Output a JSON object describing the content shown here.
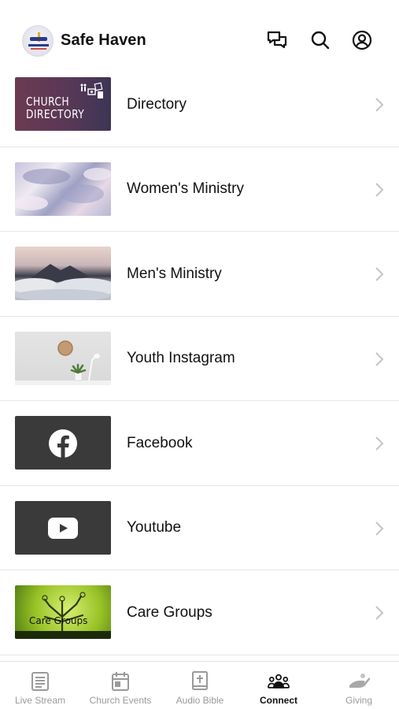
{
  "header": {
    "title": "Safe Haven",
    "icons": [
      "church-logo",
      "messages-icon",
      "search-icon",
      "account-icon"
    ]
  },
  "items": [
    {
      "label": "Directory",
      "thumb": "church-directory-image",
      "thumb_text": [
        "CHURCH",
        "DIRECTORY"
      ]
    },
    {
      "label": "Women's Ministry",
      "thumb": "pastel-clouds-image"
    },
    {
      "label": "Men's Ministry",
      "thumb": "mountain-clouds-image"
    },
    {
      "label": "Youth Instagram",
      "thumb": "clock-plant-desk-image"
    },
    {
      "label": "Facebook",
      "thumb": "facebook-icon"
    },
    {
      "label": "Youtube",
      "thumb": "youtube-icon"
    },
    {
      "label": "Care Groups",
      "thumb": "care-groups-tree-image",
      "thumb_text": [
        "Care Groups"
      ]
    }
  ],
  "tabs": [
    {
      "label": "Live Stream",
      "icon": "live-stream-icon",
      "active": false
    },
    {
      "label": "Church Events",
      "icon": "calendar-icon",
      "active": false
    },
    {
      "label": "Audio Bible",
      "icon": "bible-icon",
      "active": false
    },
    {
      "label": "Connect",
      "icon": "group-icon",
      "active": true
    },
    {
      "label": "Giving",
      "icon": "giving-hand-icon",
      "active": false
    }
  ],
  "colors": {
    "accent": "#111111",
    "inactive": "#9a9a9a",
    "divider": "#e6e6e6"
  }
}
